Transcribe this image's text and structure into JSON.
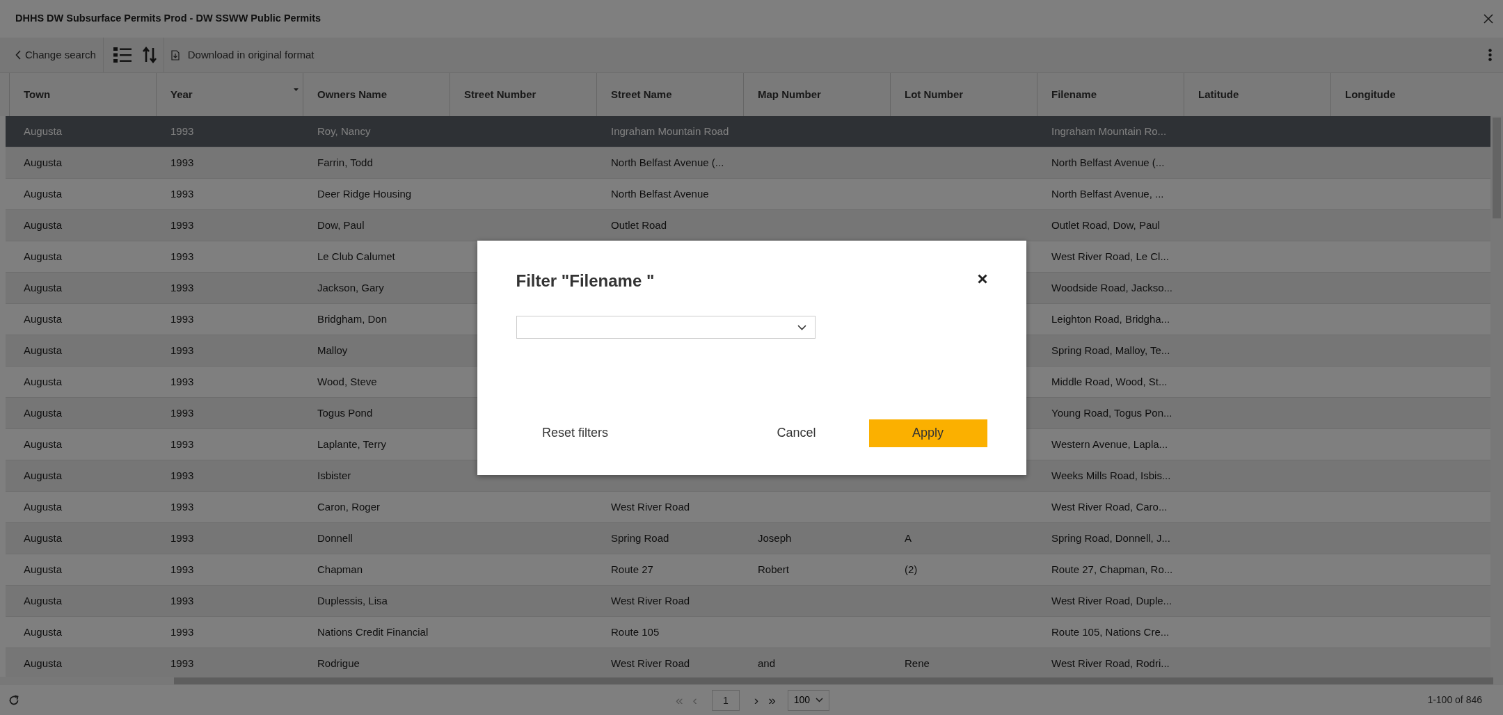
{
  "window": {
    "title": "DHHS DW Subsurface Permits Prod - DW SSWW Public Permits"
  },
  "toolbar": {
    "back": "Change search",
    "download": "Download in original format"
  },
  "table": {
    "columns": [
      {
        "label": "Town",
        "sorted": false
      },
      {
        "label": "Year",
        "sorted": true
      },
      {
        "label": "Owners Name",
        "sorted": false
      },
      {
        "label": "Street Number",
        "sorted": false
      },
      {
        "label": "Street Name",
        "sorted": false
      },
      {
        "label": "Map Number",
        "sorted": false
      },
      {
        "label": "Lot Number",
        "sorted": false
      },
      {
        "label": "Filename",
        "sorted": false
      },
      {
        "label": "Latitude",
        "sorted": false
      },
      {
        "label": "Longitude",
        "sorted": false
      }
    ],
    "rows": [
      {
        "selected": true,
        "cells": [
          "Augusta",
          "1993",
          "Roy, Nancy",
          null,
          "Ingraham Mountain Road",
          null,
          null,
          "Ingraham Mountain Ro..."
        ]
      },
      {
        "selected": false,
        "cells": [
          "Augusta",
          "1993",
          "Farrin, Todd",
          null,
          "North Belfast Avenue (...",
          null,
          null,
          "North Belfast Avenue (..."
        ]
      },
      {
        "selected": false,
        "cells": [
          "Augusta",
          "1993",
          "Deer Ridge Housing",
          null,
          "North Belfast Avenue",
          null,
          null,
          "North Belfast Avenue, ..."
        ]
      },
      {
        "selected": false,
        "cells": [
          "Augusta",
          "1993",
          "Dow, Paul",
          null,
          "Outlet Road",
          null,
          null,
          "Outlet Road, Dow, Paul"
        ]
      },
      {
        "selected": false,
        "cells": [
          "Augusta",
          "1993",
          "Le Club Calumet",
          null,
          null,
          null,
          null,
          "West River Road, Le Cl..."
        ]
      },
      {
        "selected": false,
        "cells": [
          "Augusta",
          "1993",
          "Jackson, Gary",
          null,
          null,
          null,
          null,
          "Woodside Road, Jackso..."
        ]
      },
      {
        "selected": false,
        "cells": [
          "Augusta",
          "1993",
          "Bridgham, Don",
          null,
          null,
          null,
          null,
          "Leighton Road, Bridgha..."
        ]
      },
      {
        "selected": false,
        "cells": [
          "Augusta",
          "1993",
          "Malloy",
          null,
          null,
          null,
          null,
          "Spring Road, Malloy, Te..."
        ]
      },
      {
        "selected": false,
        "cells": [
          "Augusta",
          "1993",
          "Wood, Steve",
          null,
          null,
          null,
          null,
          "Middle Road, Wood, St..."
        ]
      },
      {
        "selected": false,
        "cells": [
          "Augusta",
          "1993",
          "Togus Pond",
          null,
          null,
          null,
          null,
          "Young Road, Togus Pon..."
        ]
      },
      {
        "selected": false,
        "cells": [
          "Augusta",
          "1993",
          "Laplante, Terry",
          null,
          null,
          null,
          null,
          "Western Avenue, Lapla..."
        ]
      },
      {
        "selected": false,
        "cells": [
          "Augusta",
          "1993",
          "Isbister",
          null,
          null,
          null,
          null,
          "Weeks Mills Road, Isbis..."
        ]
      },
      {
        "selected": false,
        "cells": [
          "Augusta",
          "1993",
          "Caron, Roger",
          null,
          "West River Road",
          null,
          null,
          "West River Road, Caro..."
        ]
      },
      {
        "selected": false,
        "cells": [
          "Augusta",
          "1993",
          "Donnell",
          null,
          "Spring Road",
          "Joseph",
          "A",
          "Spring Road, Donnell, J..."
        ]
      },
      {
        "selected": false,
        "cells": [
          "Augusta",
          "1993",
          "Chapman",
          null,
          "Route 27",
          "Robert",
          "(2)",
          "Route 27, Chapman, Ro..."
        ]
      },
      {
        "selected": false,
        "cells": [
          "Augusta",
          "1993",
          "Duplessis, Lisa",
          null,
          "West River Road",
          null,
          null,
          "West River Road, Duple..."
        ]
      },
      {
        "selected": false,
        "cells": [
          "Augusta",
          "1993",
          "Nations Credit Financial",
          null,
          "Route 105",
          null,
          null,
          "Route 105, Nations Cre..."
        ]
      },
      {
        "selected": false,
        "cells": [
          "Augusta",
          "1993",
          "Rodrigue",
          null,
          "West River Road",
          "and",
          "Rene",
          "West River Road, Rodri..."
        ]
      }
    ]
  },
  "pagination": {
    "nav": [
      {
        "label": "«",
        "disabled": true
      },
      {
        "label": "‹",
        "disabled": true
      },
      {
        "label": "1",
        "kind": "page"
      },
      {
        "label": "›",
        "disabled": false
      },
      {
        "label": "»",
        "disabled": false
      }
    ],
    "page_size": "100",
    "summary": "1-100 of 846"
  },
  "dialog": {
    "title": "Filter \"Filename \"",
    "buttons": [
      {
        "label": "Reset filters",
        "kind": "link"
      },
      {
        "label": "Cancel",
        "kind": "link"
      },
      {
        "label": "Apply",
        "kind": "primary"
      }
    ]
  }
}
